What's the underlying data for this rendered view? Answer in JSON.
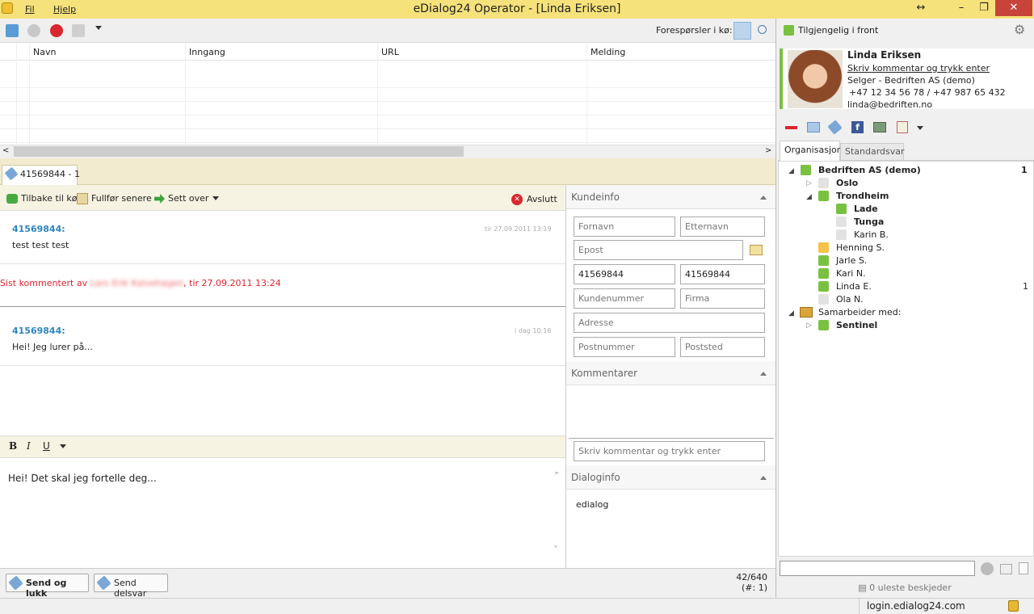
{
  "window": {
    "title": "eDialog24 Operator - [Linda Eriksen]"
  },
  "menu": {
    "file": "Fil",
    "help": "Hjelp"
  },
  "window_controls": {
    "resize": "↔",
    "minimize": "–",
    "maximize": "❐",
    "close": "✕"
  },
  "toolbar": {
    "queue_label": "Forespørsler i kø: 0"
  },
  "queue_grid": {
    "columns": [
      "Navn",
      "Inngang",
      "URL",
      "Melding"
    ]
  },
  "conversation_tab": {
    "label": "41569844 - 1"
  },
  "actions": {
    "back_to_queue": "Tilbake til kø",
    "finish_later": "Fullfør senere",
    "transfer": "Sett over",
    "end": "Avslutt"
  },
  "messages": [
    {
      "user": "41569844:",
      "time": "tir 27.09.2011 13:19",
      "text": "test test test"
    },
    {
      "user": "41569844:",
      "time": "i dag 10:16",
      "text": "Hei! Jeg lurer på..."
    }
  ],
  "comment_line": {
    "prefix": "Sist kommentert av ",
    "author": "Lars Erik Kalvehagen",
    "suffix": ", tir 27.09.2011 13:24"
  },
  "format": {
    "bold": "B",
    "italic": "I",
    "underline": "U"
  },
  "compose": {
    "text": "Hei! Det skal jeg fortelle deg..."
  },
  "bottom": {
    "send_close": "Send og lukk",
    "send_partial": "Send delsvar",
    "counter_line1": "42/640",
    "counter_line2": "(#: 1)"
  },
  "customer": {
    "section_title": "Kundeinfo",
    "fields": {
      "first_name": "Fornavn",
      "last_name": "Etternavn",
      "email": "Epost",
      "phone1": "41569844",
      "phone2": "41569844",
      "customer_no": "Kundenummer",
      "company": "Firma",
      "address": "Adresse",
      "postal_code": "Postnummer",
      "postal_place": "Poststed"
    },
    "comments_title": "Kommentarer",
    "comment_placeholder": "Skriv kommentar og trykk enter",
    "dialog_title": "Dialoginfo",
    "dialog_value": "edialog"
  },
  "right_panel": {
    "available_label": "Tilgjengelig i front",
    "profile": {
      "name": "Linda Eriksen",
      "comment_link": "Skriv kommentar og trykk enter",
      "role": "Selger - Bedriften AS (demo)",
      "phones": "+47 12 34 56 78  /  +47 987 65 432",
      "email": "linda@bedriften.no"
    },
    "tabs": [
      "Organisasjon",
      "Standardsvar"
    ],
    "tree": [
      {
        "label": "Bedriften AS (demo)",
        "bold": true,
        "count": "1",
        "status": "green"
      },
      {
        "label": "Oslo",
        "bold": true,
        "status": "grey"
      },
      {
        "label": "Trondheim",
        "bold": true,
        "status": "green"
      },
      {
        "label": "Lade",
        "bold": true,
        "status": "green"
      },
      {
        "label": "Tunga",
        "bold": true,
        "status": "grey"
      },
      {
        "label": "Karin B.",
        "bold": false,
        "status": "grey"
      },
      {
        "label": "Henning S.",
        "bold": false,
        "status": "orange"
      },
      {
        "label": "Jarle S.",
        "bold": false,
        "status": "green"
      },
      {
        "label": "Kari N.",
        "bold": false,
        "status": "green"
      },
      {
        "label": "Linda E.",
        "bold": false,
        "count": "1",
        "status": "green"
      },
      {
        "label": "Ola N.",
        "bold": false,
        "status": "grey"
      },
      {
        "label": "Samarbeider med:",
        "bold": false,
        "status": "partner"
      },
      {
        "label": "Sentinel",
        "bold": true,
        "status": "green"
      }
    ],
    "unread": "0 uleste beskjeder"
  },
  "status": {
    "server": "login.edialog24.com"
  },
  "colors": {
    "title_bar": "#f6e27a",
    "link_blue": "#2d86c4",
    "alert_red": "#e0242a",
    "online_green": "#7ac142"
  }
}
